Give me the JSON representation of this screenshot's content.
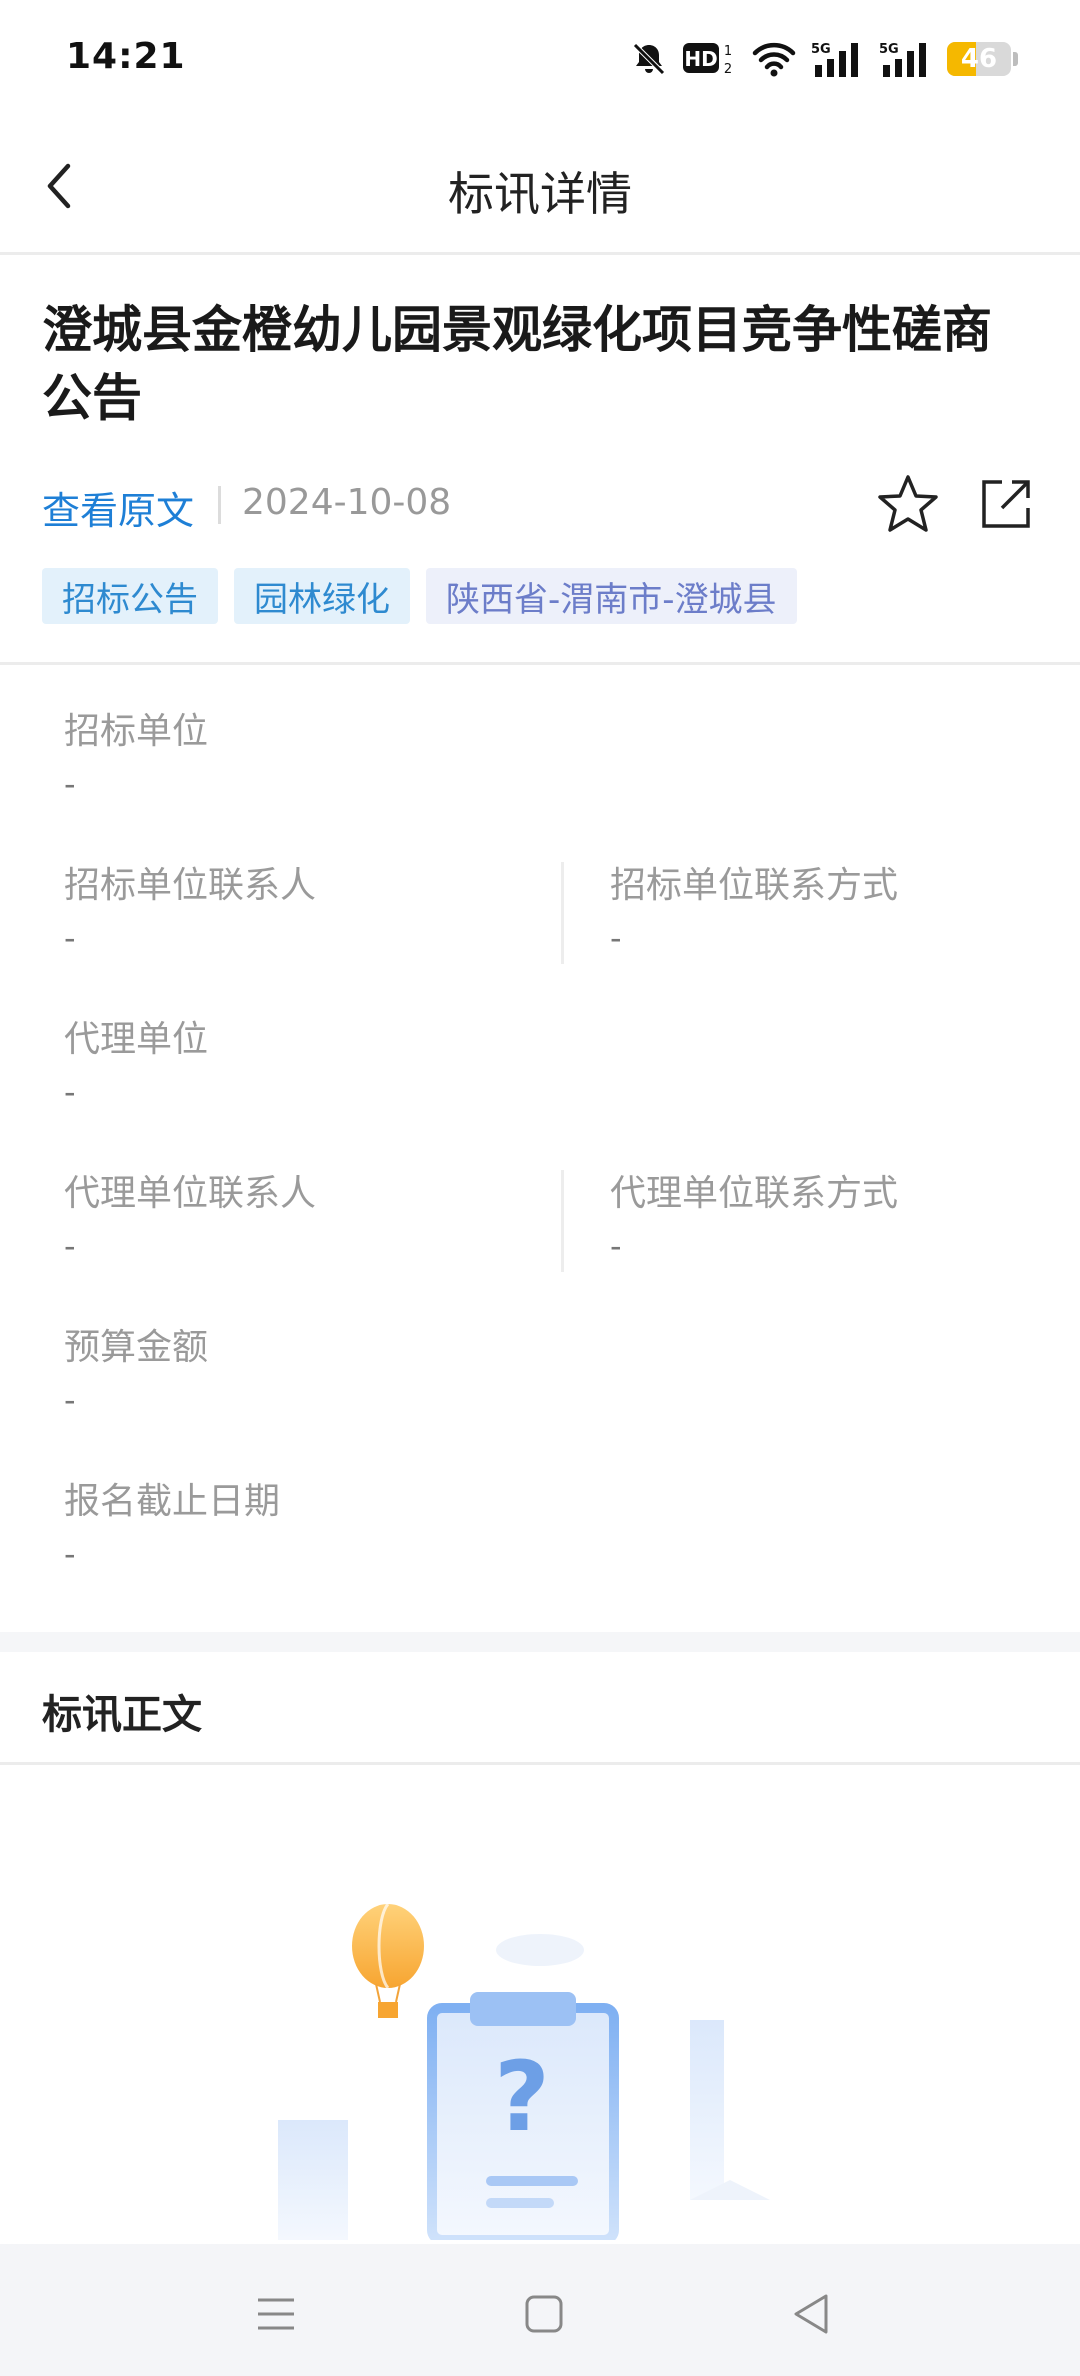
{
  "status_bar": {
    "time": "14:21",
    "battery": "46",
    "icons": [
      "mute-bell-icon",
      "hd-icon",
      "wifi-icon",
      "signal-5g-icon",
      "signal-5g-icon",
      "battery-icon"
    ]
  },
  "nav": {
    "title": "标讯详情",
    "back_icon": "chevron-left-icon"
  },
  "notice": {
    "title": "澄城县金橙幼儿园景观绿化项目竞争性磋商公告",
    "view_original": "查看原文",
    "date": "2024-10-08",
    "tags": [
      "招标公告",
      "园林绿化",
      "陕西省-渭南市-澄城县"
    ]
  },
  "info": {
    "tender_unit": {
      "label": "招标单位",
      "value": "-"
    },
    "tender_contact": {
      "label": "招标单位联系人",
      "value": "-"
    },
    "tender_contact_method": {
      "label": "招标单位联系方式",
      "value": "-"
    },
    "agent_unit": {
      "label": "代理单位",
      "value": "-"
    },
    "agent_contact": {
      "label": "代理单位联系人",
      "value": "-"
    },
    "agent_contact_method": {
      "label": "代理单位联系方式",
      "value": "-"
    },
    "budget": {
      "label": "预算金额",
      "value": "-"
    },
    "deadline": {
      "label": "报名截止日期",
      "value": "-"
    }
  },
  "body": {
    "header": "标讯正文"
  },
  "colors": {
    "accent": "#1e7fd6",
    "tag_bg": "#e3f1fb",
    "tag_region_bg": "#edf0fa",
    "battery": "#f5b800"
  }
}
